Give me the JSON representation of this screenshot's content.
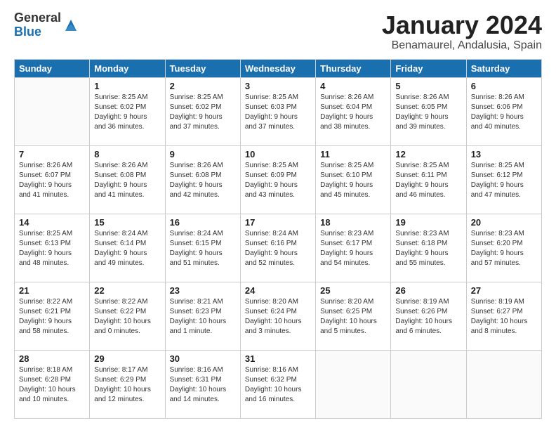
{
  "logo": {
    "general": "General",
    "blue": "Blue"
  },
  "title": {
    "month": "January 2024",
    "location": "Benamaurel, Andalusia, Spain"
  },
  "headers": [
    "Sunday",
    "Monday",
    "Tuesday",
    "Wednesday",
    "Thursday",
    "Friday",
    "Saturday"
  ],
  "weeks": [
    [
      {
        "day": "",
        "info": ""
      },
      {
        "day": "1",
        "info": "Sunrise: 8:25 AM\nSunset: 6:02 PM\nDaylight: 9 hours\nand 36 minutes."
      },
      {
        "day": "2",
        "info": "Sunrise: 8:25 AM\nSunset: 6:02 PM\nDaylight: 9 hours\nand 37 minutes."
      },
      {
        "day": "3",
        "info": "Sunrise: 8:25 AM\nSunset: 6:03 PM\nDaylight: 9 hours\nand 37 minutes."
      },
      {
        "day": "4",
        "info": "Sunrise: 8:26 AM\nSunset: 6:04 PM\nDaylight: 9 hours\nand 38 minutes."
      },
      {
        "day": "5",
        "info": "Sunrise: 8:26 AM\nSunset: 6:05 PM\nDaylight: 9 hours\nand 39 minutes."
      },
      {
        "day": "6",
        "info": "Sunrise: 8:26 AM\nSunset: 6:06 PM\nDaylight: 9 hours\nand 40 minutes."
      }
    ],
    [
      {
        "day": "7",
        "info": "Sunrise: 8:26 AM\nSunset: 6:07 PM\nDaylight: 9 hours\nand 41 minutes."
      },
      {
        "day": "8",
        "info": "Sunrise: 8:26 AM\nSunset: 6:08 PM\nDaylight: 9 hours\nand 41 minutes."
      },
      {
        "day": "9",
        "info": "Sunrise: 8:26 AM\nSunset: 6:08 PM\nDaylight: 9 hours\nand 42 minutes."
      },
      {
        "day": "10",
        "info": "Sunrise: 8:25 AM\nSunset: 6:09 PM\nDaylight: 9 hours\nand 43 minutes."
      },
      {
        "day": "11",
        "info": "Sunrise: 8:25 AM\nSunset: 6:10 PM\nDaylight: 9 hours\nand 45 minutes."
      },
      {
        "day": "12",
        "info": "Sunrise: 8:25 AM\nSunset: 6:11 PM\nDaylight: 9 hours\nand 46 minutes."
      },
      {
        "day": "13",
        "info": "Sunrise: 8:25 AM\nSunset: 6:12 PM\nDaylight: 9 hours\nand 47 minutes."
      }
    ],
    [
      {
        "day": "14",
        "info": "Sunrise: 8:25 AM\nSunset: 6:13 PM\nDaylight: 9 hours\nand 48 minutes."
      },
      {
        "day": "15",
        "info": "Sunrise: 8:24 AM\nSunset: 6:14 PM\nDaylight: 9 hours\nand 49 minutes."
      },
      {
        "day": "16",
        "info": "Sunrise: 8:24 AM\nSunset: 6:15 PM\nDaylight: 9 hours\nand 51 minutes."
      },
      {
        "day": "17",
        "info": "Sunrise: 8:24 AM\nSunset: 6:16 PM\nDaylight: 9 hours\nand 52 minutes."
      },
      {
        "day": "18",
        "info": "Sunrise: 8:23 AM\nSunset: 6:17 PM\nDaylight: 9 hours\nand 54 minutes."
      },
      {
        "day": "19",
        "info": "Sunrise: 8:23 AM\nSunset: 6:18 PM\nDaylight: 9 hours\nand 55 minutes."
      },
      {
        "day": "20",
        "info": "Sunrise: 8:23 AM\nSunset: 6:20 PM\nDaylight: 9 hours\nand 57 minutes."
      }
    ],
    [
      {
        "day": "21",
        "info": "Sunrise: 8:22 AM\nSunset: 6:21 PM\nDaylight: 9 hours\nand 58 minutes."
      },
      {
        "day": "22",
        "info": "Sunrise: 8:22 AM\nSunset: 6:22 PM\nDaylight: 10 hours\nand 0 minutes."
      },
      {
        "day": "23",
        "info": "Sunrise: 8:21 AM\nSunset: 6:23 PM\nDaylight: 10 hours\nand 1 minute."
      },
      {
        "day": "24",
        "info": "Sunrise: 8:20 AM\nSunset: 6:24 PM\nDaylight: 10 hours\nand 3 minutes."
      },
      {
        "day": "25",
        "info": "Sunrise: 8:20 AM\nSunset: 6:25 PM\nDaylight: 10 hours\nand 5 minutes."
      },
      {
        "day": "26",
        "info": "Sunrise: 8:19 AM\nSunset: 6:26 PM\nDaylight: 10 hours\nand 6 minutes."
      },
      {
        "day": "27",
        "info": "Sunrise: 8:19 AM\nSunset: 6:27 PM\nDaylight: 10 hours\nand 8 minutes."
      }
    ],
    [
      {
        "day": "28",
        "info": "Sunrise: 8:18 AM\nSunset: 6:28 PM\nDaylight: 10 hours\nand 10 minutes."
      },
      {
        "day": "29",
        "info": "Sunrise: 8:17 AM\nSunset: 6:29 PM\nDaylight: 10 hours\nand 12 minutes."
      },
      {
        "day": "30",
        "info": "Sunrise: 8:16 AM\nSunset: 6:31 PM\nDaylight: 10 hours\nand 14 minutes."
      },
      {
        "day": "31",
        "info": "Sunrise: 8:16 AM\nSunset: 6:32 PM\nDaylight: 10 hours\nand 16 minutes."
      },
      {
        "day": "",
        "info": ""
      },
      {
        "day": "",
        "info": ""
      },
      {
        "day": "",
        "info": ""
      }
    ]
  ]
}
